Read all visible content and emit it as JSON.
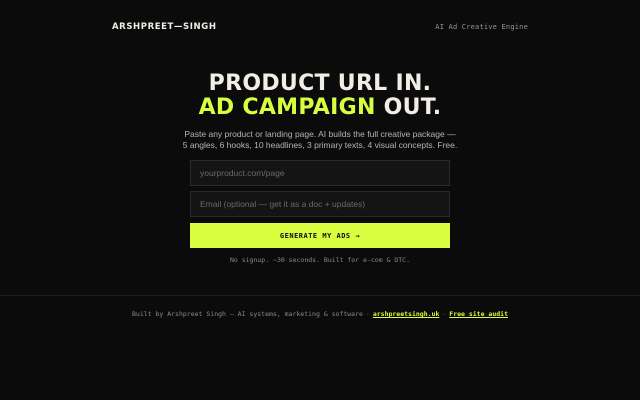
{
  "header": {
    "brand": "ARSHPREET—SINGH",
    "tagline": "AI Ad Creative Engine"
  },
  "hero": {
    "headline_line1": "PRODUCT URL IN.",
    "headline_accent": "AD CAMPAIGN",
    "headline_line2_end": " OUT.",
    "subtitle_line1": "Paste any product or landing page. AI builds the full creative package —",
    "subtitle_line2": "5 angles, 6 hooks, 10 headlines, 3 primary texts, 4 visual concepts. Free."
  },
  "form": {
    "url_placeholder": "yourproduct.com/page",
    "email_placeholder": "Email (optional — get it as a doc + updates)",
    "submit_label": "GENERATE MY ADS →",
    "note": "No signup. ~30 seconds. Built for e-com & DTC."
  },
  "footer": {
    "credit": "Built by Arshpreet Singh — AI systems, marketing & software",
    "separator": "·",
    "site_link": "arshpreetsingh.uk",
    "audit_link": "Free site audit"
  },
  "colors": {
    "background": "#0b0b0b",
    "accent": "#d8ff3f",
    "text": "#f2eee6"
  }
}
